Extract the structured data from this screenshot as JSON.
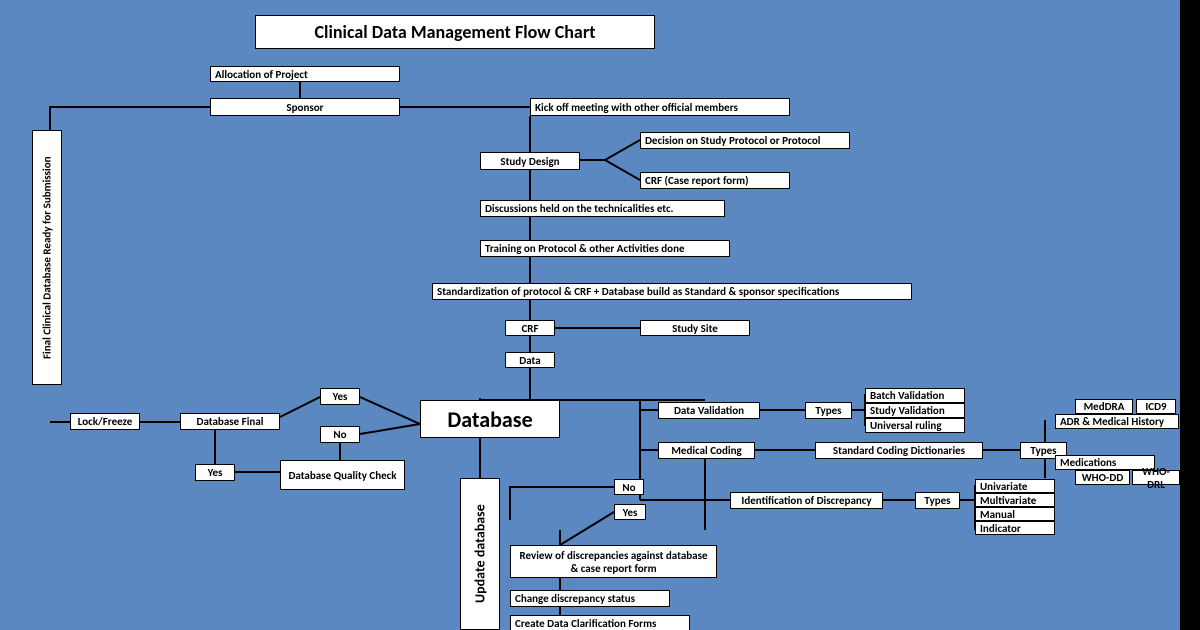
{
  "title": "Clinical Data Management Flow Chart",
  "nodes": {
    "allocation": "Allocation of Project",
    "sponsor": "Sponsor",
    "kickoff": "Kick off meeting with other official members",
    "study_design": "Study Design",
    "decision_protocol": "Decision on Study Protocol or Protocol",
    "crf_form": "CRF (Case report form)",
    "discussions": "Discussions held on the technicalities etc.",
    "training": "Training on Protocol & other Activities done",
    "standardization": "Standardization of protocol & CRF + Database build as Standard & sponsor specifications",
    "crf": "CRF",
    "study_site": "Study Site",
    "data": "Data",
    "database": "Database",
    "update_database": "Update database",
    "data_validation": "Data Validation",
    "types_1": "Types",
    "batch_validation": "Batch Validation",
    "study_validation": "Study Validation",
    "universal_ruling": "Universal ruling",
    "medical_coding": "Medical Coding",
    "standard_coding": "Standard Coding Dictionaries",
    "types_2": "Types",
    "meddra": "MedDRA",
    "icd9": "ICD9",
    "adr_history": "ADR & Medical History",
    "medications": "Medications",
    "who_dd": "WHO-DD",
    "who_drl": "WHO-DRL",
    "no": "No",
    "yes_right": "Yes",
    "identification": "Identification of Discrepancy",
    "types_3": "Types",
    "univariate": "Univariate",
    "multivariate": "Multivariate",
    "manual": "Manual",
    "indicator": "Indicator",
    "review": "Review of discrepancies against database & case report form",
    "change_status": "Change discrepancy status",
    "create_dcf": "Create Data Clarification Forms",
    "yes_top": "Yes",
    "no_mid": "No",
    "db_quality": "Database Quality Check",
    "db_final": "Database Final",
    "yes_left": "Yes",
    "lock_freeze": "Lock/Freeze",
    "final_db_ready": "Final Clinical Database Ready for Submission"
  }
}
